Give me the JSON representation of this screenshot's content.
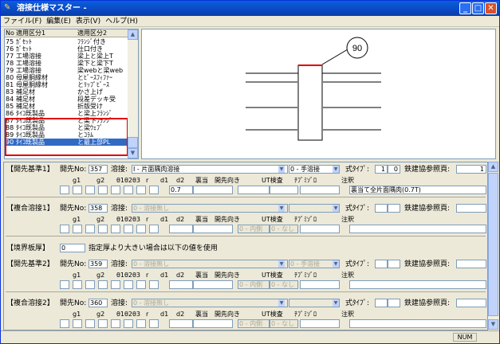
{
  "window": {
    "title": "溶接仕様マスター -"
  },
  "menu": [
    "ファイル(F)",
    "編集(E)",
    "表示(V)",
    "ヘルプ(H)"
  ],
  "list": {
    "headers": [
      "No",
      "適用区分1",
      "適用区分2"
    ],
    "rows": [
      [
        "75",
        "ｶﾞｾｯﾄ",
        "ﾌﾗﾝｼﾞ付き"
      ],
      [
        "76",
        "ｶﾞｾｯﾄ",
        "仕口付き"
      ],
      [
        "77",
        "工場溶接",
        "梁上と梁上T"
      ],
      [
        "78",
        "工場溶接",
        "梁下と梁下T"
      ],
      [
        "79",
        "工場溶接",
        "梁webと梁web"
      ],
      [
        "80",
        "母屋胴縁材",
        "とﾋﾞｰｽﾌｨﾌｧｰ"
      ],
      [
        "81",
        "母屋胴縁材",
        "とﾘｯﾌﾟﾋﾞｰｽ"
      ],
      [
        "83",
        "補足材",
        "かさ上げ"
      ],
      [
        "84",
        "補足材",
        "段差デッキ受"
      ],
      [
        "85",
        "補足材",
        "折版受け"
      ],
      [
        "86",
        "ﾀｲｺ既製品",
        "と梁上ﾌﾗﾝｼﾞ"
      ],
      [
        "87",
        "ﾀｲｺ既製品",
        "と梁下ﾌﾗﾝｼﾞ"
      ],
      [
        "88",
        "ﾀｲｺ既製品",
        "と梁ｳｪﾌﾞ"
      ],
      [
        "89",
        "ﾀｲｺ既製品",
        "とｺﾗﾑ"
      ],
      [
        "90",
        "ﾀｲｺ既製品",
        "と最上部PL"
      ]
    ],
    "selected_index": 14
  },
  "drawing": {
    "callout": "90"
  },
  "sections": [
    {
      "title": "【開先基準1】",
      "no_label": "開先No:",
      "no_value": "357",
      "weld_label": "溶接:",
      "weld_value": "I - 片面隅肉溶接",
      "method_value": "0 - 手溶接",
      "formula_label": "式ﾀｲﾌﾟ:",
      "formula_value": "1",
      "extra_value": "0",
      "ref_label": "鉄建協参照頁:",
      "ref_value": "1",
      "columns": [
        "g1",
        "g2",
        "θ1",
        "θ2",
        "θ3",
        "r",
        "d1",
        "d2",
        "裏当",
        "開先向き",
        "UT検査",
        "ﾁﾌﾞﾐｿﾞﾛ",
        "注釈"
      ],
      "d1_value": "0.7",
      "dir_value": "",
      "ut_value": "",
      "note_value": "裏当て全片面隅肉(0.7T)",
      "disabled": false
    },
    {
      "title": "【複合溶接1】",
      "no_label": "開先No:",
      "no_value": "358",
      "weld_label": "溶接:",
      "weld_value": "0 - 溶接無し",
      "method_value": "",
      "formula_label": "式ﾀｲﾌﾟ:",
      "formula_value": "",
      "extra_value": "",
      "ref_label": "鉄建協参照頁:",
      "ref_value": "",
      "columns": [
        "g1",
        "g2",
        "θ1",
        "θ2",
        "θ3",
        "r",
        "d1",
        "d2",
        "裏当",
        "開先向き",
        "UT検査",
        "ﾁﾌﾞﾐｿﾞﾛ",
        "注釈"
      ],
      "d1_value": "",
      "dir_value": "0 - 内側",
      "ut_value": "0 - なし",
      "note_value": "",
      "disabled": true
    },
    {
      "title": "【開先基準2】",
      "no_label": "開先No:",
      "no_value": "359",
      "weld_label": "溶接:",
      "weld_value": "0 - 溶接無し",
      "method_value": "0 - 手溶接",
      "formula_label": "式ﾀｲﾌﾟ:",
      "formula_value": "",
      "extra_value": "",
      "ref_label": "鉄建協参照頁:",
      "ref_value": "",
      "columns": [
        "g1",
        "g2",
        "θ1",
        "θ2",
        "θ3",
        "r",
        "d1",
        "d2",
        "裏当",
        "開先向き",
        "UT検査",
        "ﾁﾌﾞﾐｿﾞﾛ",
        "注釈"
      ],
      "d1_value": "",
      "dir_value": "0 - 内側",
      "ut_value": "0 - なし",
      "note_value": "",
      "disabled": true
    },
    {
      "title": "【複合溶接2】",
      "no_label": "開先No:",
      "no_value": "360",
      "weld_label": "溶接:",
      "weld_value": "0 - 溶接無し",
      "method_value": "",
      "formula_label": "式ﾀｲﾌﾟ:",
      "formula_value": "",
      "extra_value": "",
      "ref_label": "鉄建協参照頁:",
      "ref_value": "",
      "columns": [
        "g1",
        "g2",
        "θ1",
        "θ2",
        "θ3",
        "r",
        "d1",
        "d2",
        "裏当",
        "開先向き",
        "UT検査",
        "ﾁﾌﾞﾐｿﾞﾛ",
        "注釈"
      ],
      "d1_value": "",
      "dir_value": "0 - 内側",
      "ut_value": "0 - なし",
      "note_value": "",
      "disabled": true
    }
  ],
  "boundary": {
    "label": "【境界板厚】",
    "value": "0",
    "text": "指定厚より大きい場合は以下の値を使用"
  },
  "status": {
    "num": "NUM"
  }
}
